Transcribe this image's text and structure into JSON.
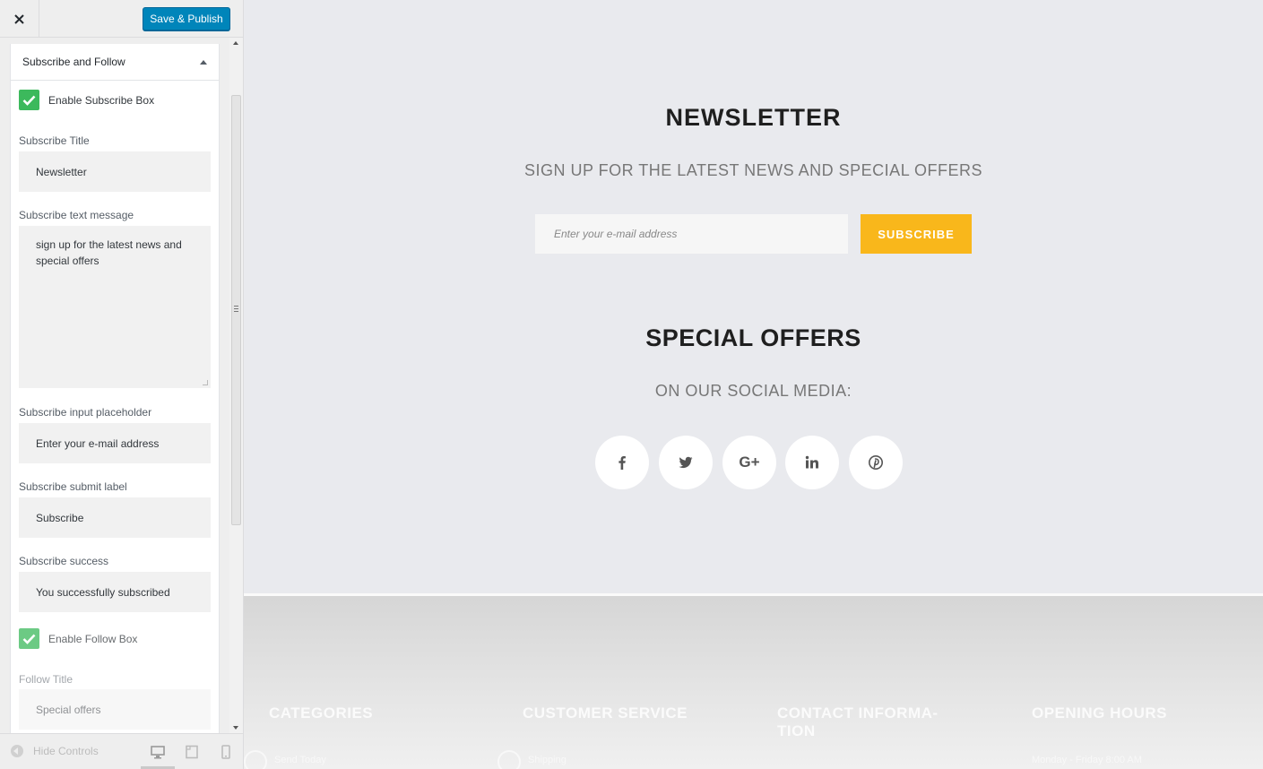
{
  "toolbar": {
    "save_label": "Save & Publish"
  },
  "section": {
    "title": "Subscribe and Follow",
    "enable_subscribe_label": "Enable Subscribe Box",
    "enable_subscribe_checked": true,
    "subscribe_title_label": "Subscribe Title",
    "subscribe_title_value": "Newsletter",
    "subscribe_text_label": "Subscribe text message",
    "subscribe_text_value": "sign up for the latest news and special offers",
    "subscribe_placeholder_label": "Subscribe input placeholder",
    "subscribe_placeholder_value": "Enter your e-mail address",
    "subscribe_submit_label": "Subscribe submit label",
    "subscribe_submit_value": "Subscribe",
    "subscribe_success_label": "Subscribe success",
    "subscribe_success_value": "You successfully subscribed",
    "enable_follow_label": "Enable Follow Box",
    "enable_follow_checked": true,
    "follow_title_label": "Follow Title",
    "follow_title_value": "Special offers"
  },
  "footer_controls": {
    "hide_controls_label": "Hide Controls",
    "devices": [
      "desktop-icon",
      "tablet-icon",
      "mobile-icon"
    ]
  },
  "preview": {
    "newsletter_title": "NEWSLETTER",
    "newsletter_subtitle": "SIGN UP FOR THE LATEST NEWS AND SPECIAL OFFERS",
    "email_placeholder": "Enter your e-mail address",
    "subscribe_button": "SUBSCRIBE",
    "special_offers_title": "SPECIAL OFFERS",
    "special_offers_subtitle": "ON OUR SOCIAL MEDIA:",
    "social": [
      "facebook-icon",
      "twitter-icon",
      "google-plus-icon",
      "linkedin-icon",
      "pinterest-icon"
    ],
    "google_plus_text": "G+",
    "footer_columns": [
      "CATEGORIES",
      "CUSTOMER SERVICE",
      "CONTACT INFORMA-TION",
      "OPENING HOURS"
    ],
    "footer_links": [
      "Send Today",
      "Shipping",
      "Monday - Friday 8:00 AM"
    ]
  },
  "colors": {
    "publish_button": "#0085ba",
    "checkbox_green": "#3cb95c",
    "subscribe_yellow": "#f9b71b",
    "preview_background": "#e9eaee"
  }
}
